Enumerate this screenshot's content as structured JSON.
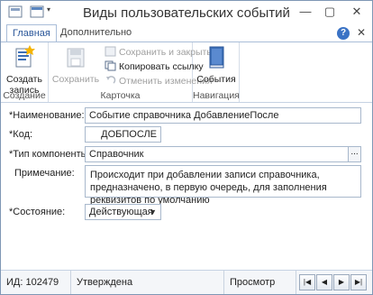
{
  "window": {
    "title": "Виды пользовательских событий"
  },
  "ribbon": {
    "tabs": [
      {
        "label": "Главная",
        "active": true
      },
      {
        "label": "Дополнительно",
        "active": false
      }
    ],
    "help_label": "?",
    "close_label": "✕",
    "groups": {
      "create": {
        "label": "Создание",
        "create_button": "Создать запись"
      },
      "card": {
        "label": "Карточка",
        "save_button": "Сохранить",
        "save_close": "Сохранить и закрыть",
        "copy_link": "Копировать ссылку",
        "cancel_changes": "Отменить изменения"
      },
      "navigation": {
        "label": "Навигация",
        "events_button": "События"
      }
    }
  },
  "form": {
    "name_label": "*Наименование:",
    "name_value": "Событие справочника ДобавлениеПосле",
    "code_label": "*Код:",
    "code_value": "ДОБПОСЛЕ",
    "component_label": "*Тип компоненты:",
    "component_value": "Справочник",
    "component_button": "...",
    "note_label": "Примечание:",
    "note_value": "Происходит при добавлении записи справочника, предназначено, в первую очередь, для заполнения реквизитов по умолчанию",
    "state_label": "*Состояние:",
    "state_value": "Действующая"
  },
  "statusbar": {
    "id_text": "ИД: 102479",
    "status_text": "Утверждена",
    "mode_text": "Просмотр",
    "nav": [
      "|◀",
      "◀",
      "▶",
      "▶|"
    ]
  },
  "colors": {
    "accent": "#2b579a",
    "border": "#7f97b5"
  }
}
